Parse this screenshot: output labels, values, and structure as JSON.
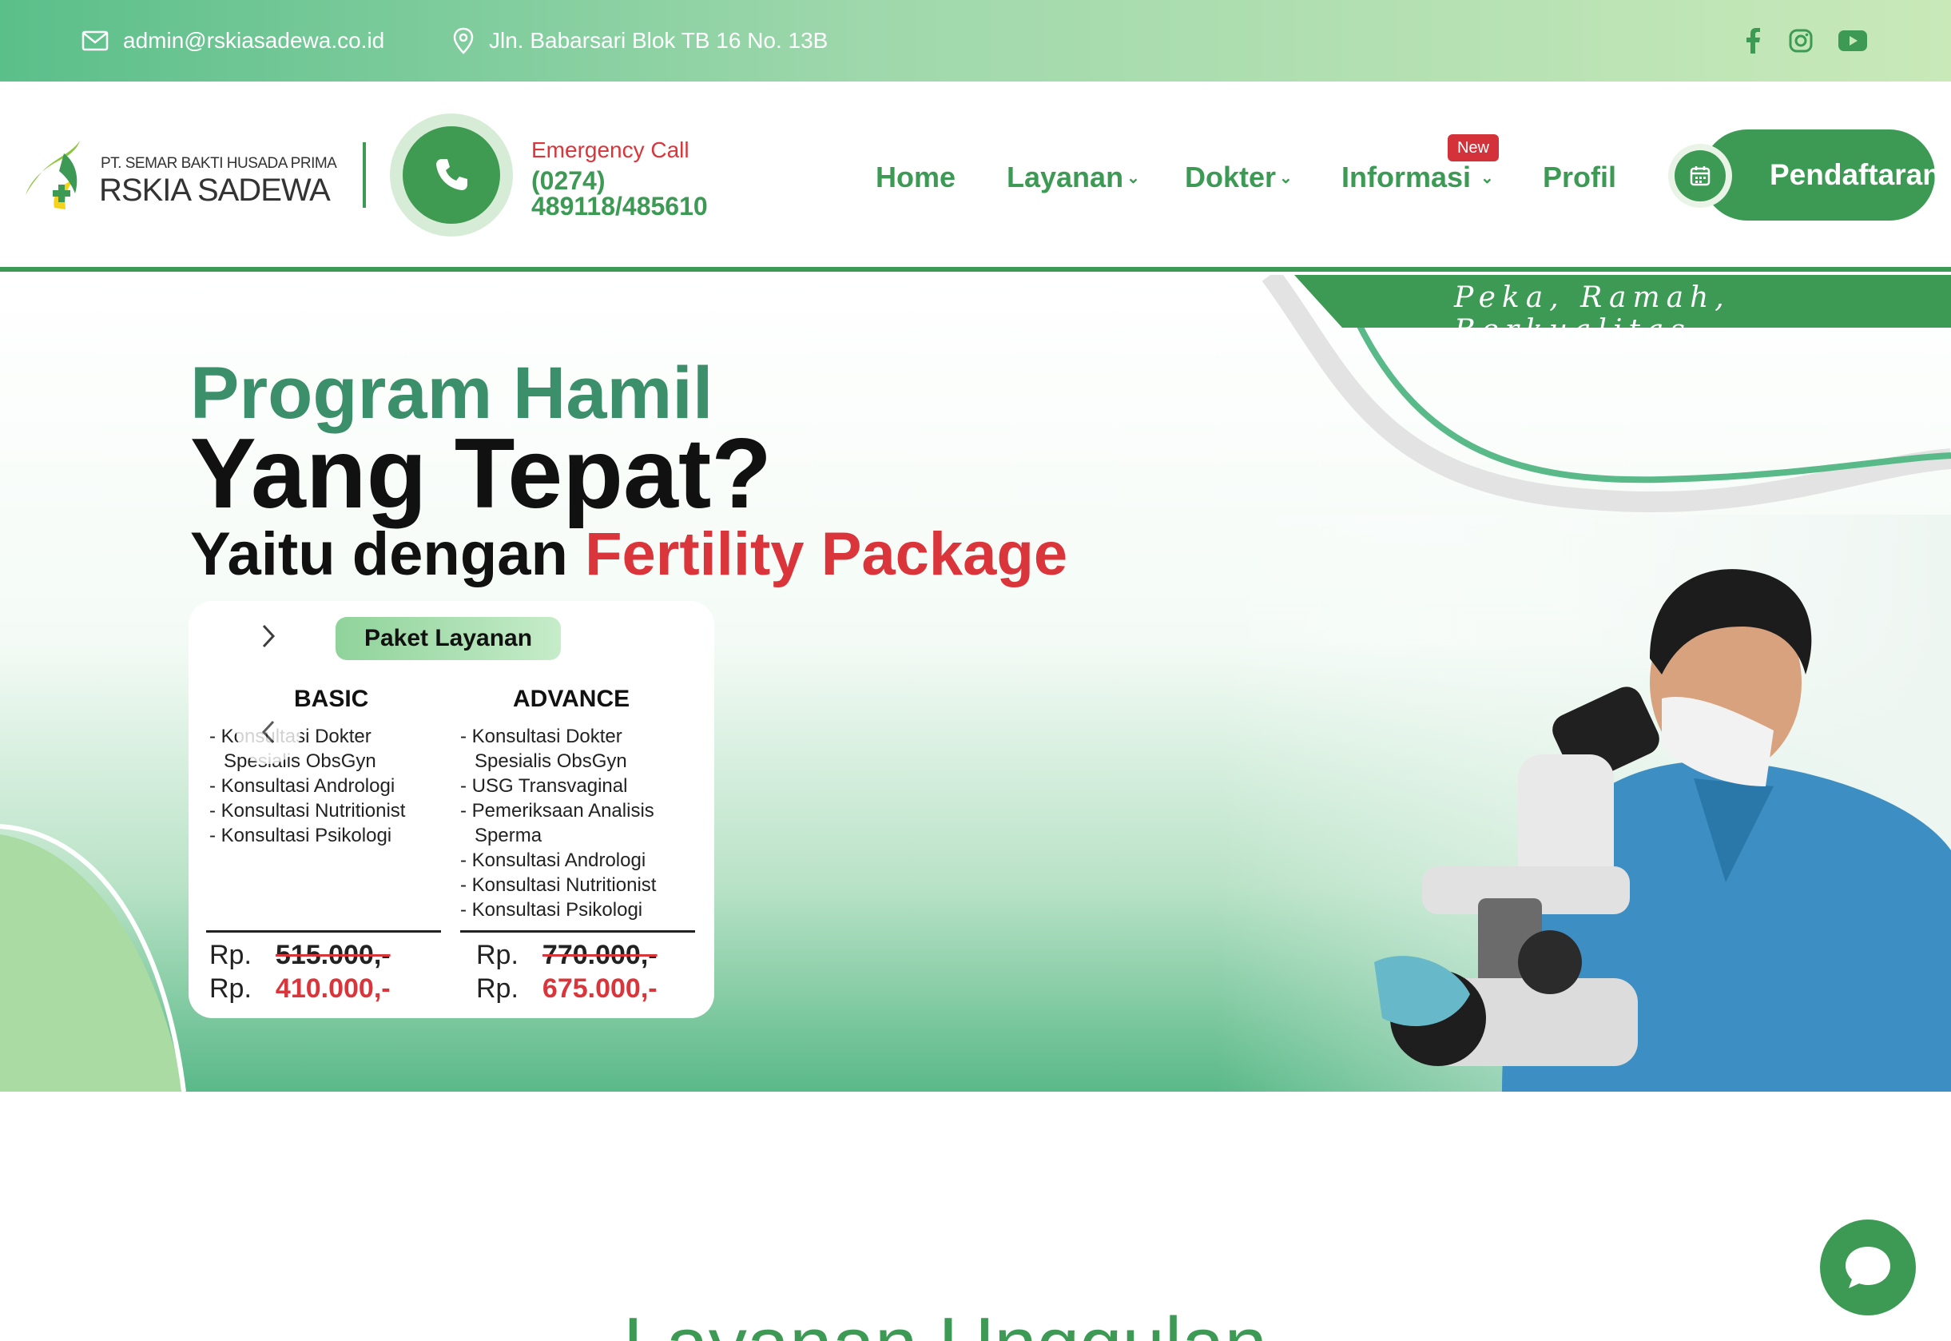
{
  "topbar": {
    "email": "admin@rskiasadewa.co.id",
    "address": "Jln. Babarsari Blok TB 16 No. 13B",
    "socials": [
      "facebook-icon",
      "instagram-icon",
      "youtube-icon"
    ]
  },
  "header": {
    "logo_sub": "PT. SEMAR BAKTI HUSADA PRIMA",
    "logo_main": "RSKIA SADEWA",
    "emergency_label": "Emergency Call",
    "emergency_number": "(0274) 489118/485610",
    "nav": [
      {
        "label": "Home"
      },
      {
        "label": "Layanan"
      },
      {
        "label": "Dokter"
      },
      {
        "label": "Informasi"
      },
      {
        "label": "Profil"
      }
    ],
    "new_badge": "New",
    "cta": "Pendaftaran"
  },
  "hero": {
    "tagline": "Peka, Ramah, Berkualitas",
    "title_line1": "Program Hamil",
    "title_line2": "Yang Tepat?",
    "title_line3_prefix": "Yaitu dengan ",
    "title_line3_highlight": "Fertility Package",
    "pill": "Paket Layanan",
    "basic": {
      "title": "BASIC",
      "items": [
        "Konsultasi Dokter Spesialis ObsGyn",
        "Konsultasi Andrologi",
        "Konsultasi Nutritionist",
        "Konsultasi Psikologi"
      ],
      "currency": "Rp.",
      "old_price": "515.000,-",
      "new_price": "410.000,-"
    },
    "advance": {
      "title": "ADVANCE",
      "items": [
        "Konsultasi Dokter Spesialis ObsGyn",
        "USG Transvaginal",
        "Pemeriksaan Analisis Sperma",
        "Konsultasi Andrologi",
        "Konsultasi Nutritionist",
        "Konsultasi Psikologi"
      ],
      "currency": "Rp.",
      "old_price": "770.000,-",
      "new_price": "675.000,-"
    }
  },
  "colors": {
    "primary": "#3d9a55",
    "accent_red": "#d9353a"
  },
  "section": {
    "title": "Layanan Unggulan"
  }
}
